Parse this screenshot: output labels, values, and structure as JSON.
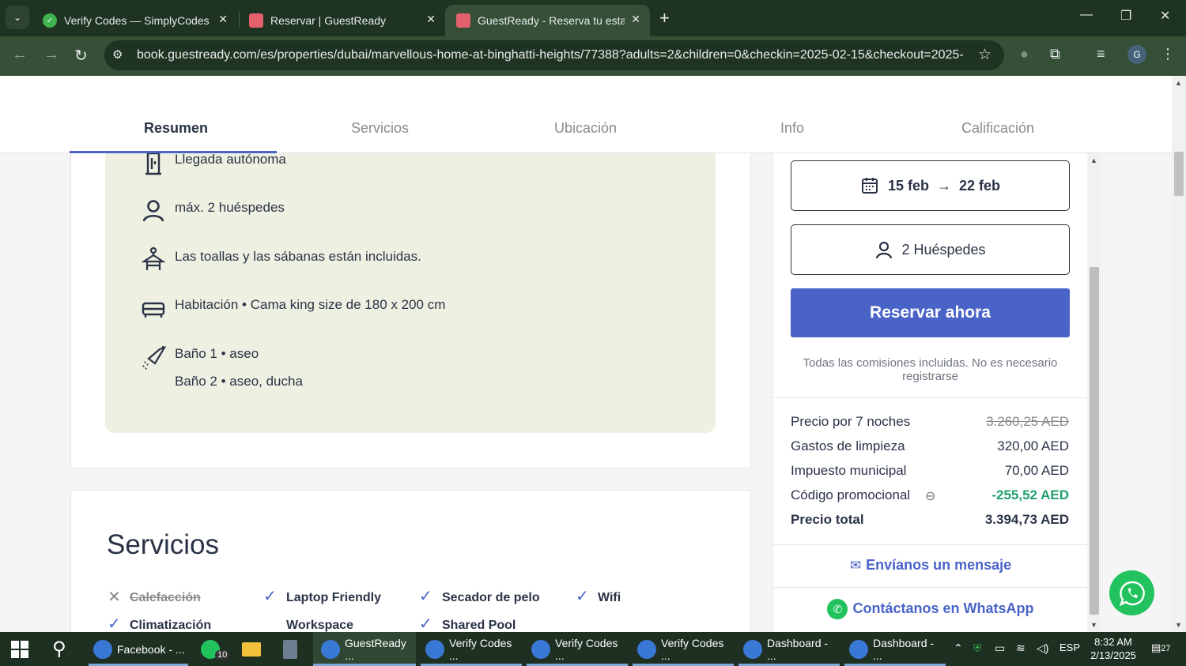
{
  "browser": {
    "tabs": [
      {
        "title": "Verify Codes — SimplyCodes",
        "close": "✕"
      },
      {
        "title": "Reservar | GuestReady",
        "close": "✕"
      },
      {
        "title": "GuestReady - Reserva tu estanc",
        "close": "✕"
      }
    ],
    "new_tab": "+",
    "url": "book.guestready.com/es/properties/dubai/marvellous-home-at-binghatti-heights/77388?adults=2&children=0&checkin=2025-02-15&checkout=2025-...",
    "profile_initial": "G"
  },
  "subnav": {
    "items": [
      "Resumen",
      "Servicios",
      "Ubicación",
      "Info",
      "Calificación"
    ],
    "active": "Resumen"
  },
  "features": [
    {
      "icon": "door-icon",
      "text": "Llegada autónoma"
    },
    {
      "icon": "person-icon",
      "text": "máx. 2 huéspedes"
    },
    {
      "icon": "hanger-icon",
      "text": "Las toallas y las sábanas están incluidas."
    },
    {
      "icon": "bed-icon",
      "text": "Habitación • Cama king size de 180 x 200 cm"
    },
    {
      "icon": "shower-icon",
      "text": "Baño 1 • aseo"
    },
    {
      "icon": "",
      "text": "Baño 2 • aseo, ducha"
    }
  ],
  "services": {
    "title": "Servicios",
    "items": [
      {
        "label": "Calefacción",
        "available": false
      },
      {
        "label": "Laptop Friendly",
        "available": true
      },
      {
        "label": "Secador de pelo",
        "available": true
      },
      {
        "label": "Wifi",
        "available": true
      },
      {
        "label": "Climatización",
        "available": true
      },
      {
        "label": "Workspace",
        "available": true
      },
      {
        "label": "Shared Pool",
        "available": true
      }
    ]
  },
  "booking": {
    "dates": {
      "from": "15 feb",
      "arrow": "→",
      "to": "22 feb"
    },
    "guests": "2 Huéspedes",
    "book_button": "Reservar ahora",
    "fees_note": "Todas las comisiones incluidas. No es necesario registrarse",
    "price_rows": [
      {
        "label": "Precio por 7 noches",
        "value": "3.260,25 AED"
      },
      {
        "label": "Gastos de limpieza",
        "value": "320,00 AED"
      },
      {
        "label": "Impuesto municipal",
        "value": "70,00 AED"
      },
      {
        "label": "Código promocional",
        "value": "-255,52 AED"
      },
      {
        "label": "Precio total",
        "value": "3.394,73 AED"
      }
    ],
    "message_link": "Envíanos un mensaje",
    "whatsapp_link": "Contáctanos en WhatsApp"
  },
  "taskbar": {
    "items": [
      {
        "label": "Facebook - ..."
      },
      {
        "label": "10"
      },
      {
        "label": "GuestReady ..."
      },
      {
        "label": "Verify Codes ..."
      },
      {
        "label": "Verify Codes ..."
      },
      {
        "label": "Verify Codes ..."
      },
      {
        "label": "Dashboard - ..."
      },
      {
        "label": "Dashboard - ..."
      }
    ],
    "language": "ESP",
    "time": "8:32 AM",
    "date": "2/13/2025",
    "notifications": "27"
  },
  "colors": {
    "accent": "#4a63c7",
    "promo": "#22a06b",
    "feature_bg": "#eef1e1",
    "whatsapp": "#22c35e",
    "browser_frame": "#1f3322"
  }
}
